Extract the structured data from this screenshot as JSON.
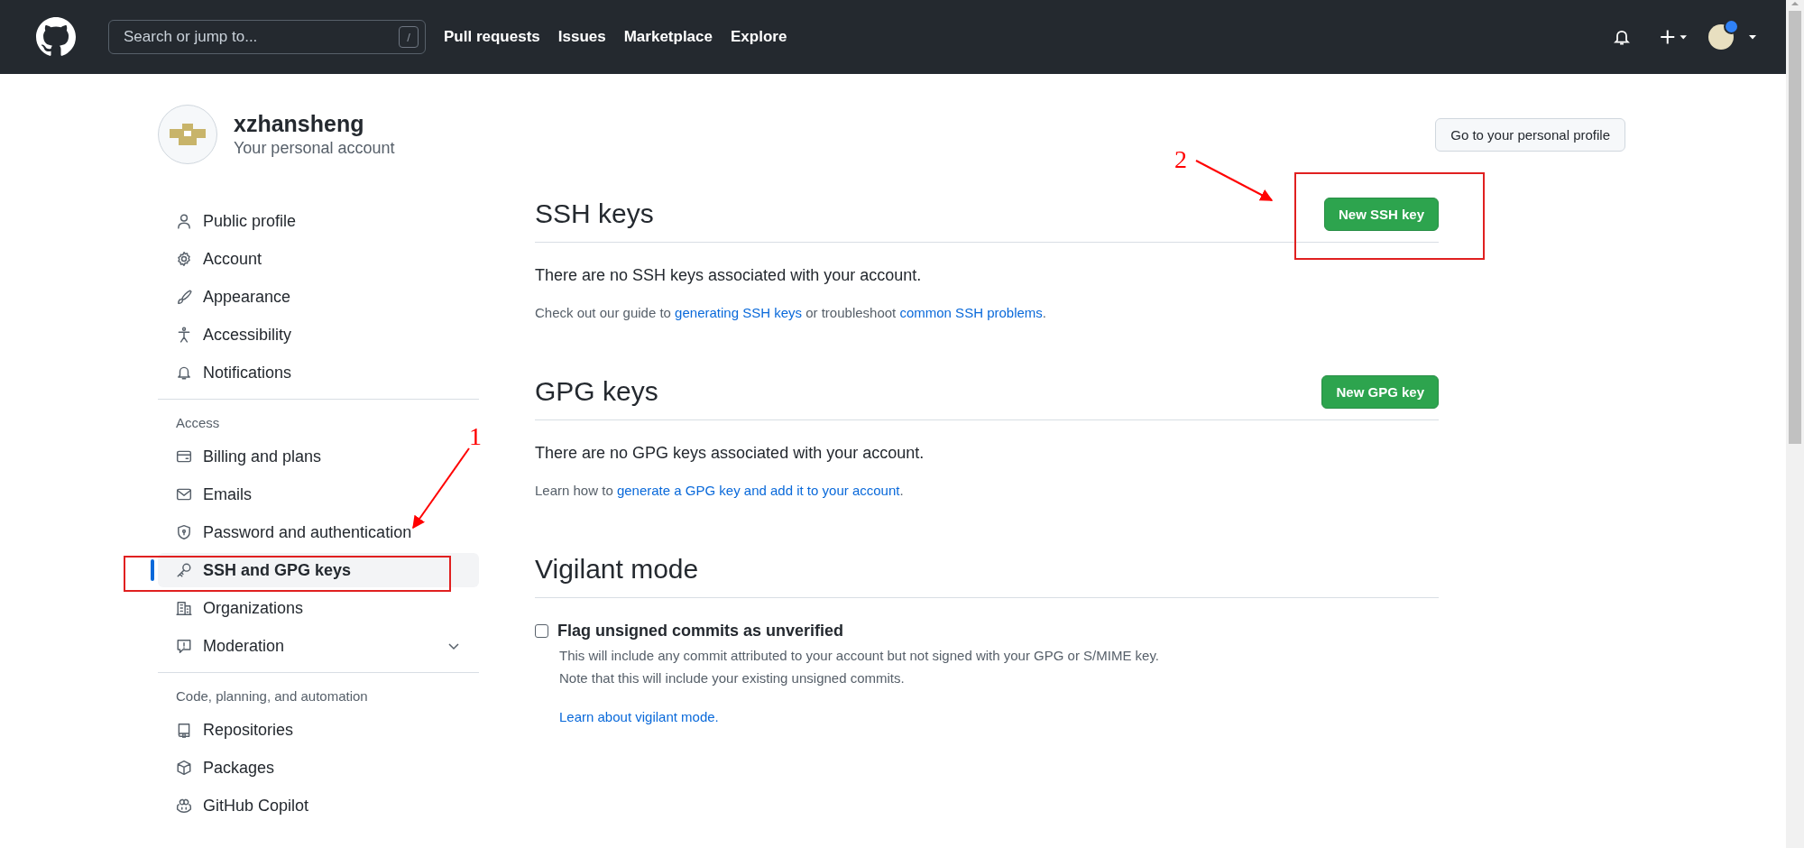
{
  "header": {
    "search": {
      "placeholder": "Search or jump to...",
      "shortcut": "/"
    },
    "nav": [
      "Pull requests",
      "Issues",
      "Marketplace",
      "Explore"
    ]
  },
  "profile": {
    "username": "xzhansheng",
    "subtitle": "Your personal account",
    "profile_button": "Go to your personal profile"
  },
  "sidebar": {
    "sections": [
      {
        "items": [
          {
            "label": "Public profile",
            "selected": false
          },
          {
            "label": "Account",
            "selected": false
          },
          {
            "label": "Appearance",
            "selected": false
          },
          {
            "label": "Accessibility",
            "selected": false
          },
          {
            "label": "Notifications",
            "selected": false
          }
        ]
      },
      {
        "heading": "Access",
        "items": [
          {
            "label": "Billing and plans",
            "selected": false
          },
          {
            "label": "Emails",
            "selected": false
          },
          {
            "label": "Password and authentication",
            "selected": false
          },
          {
            "label": "SSH and GPG keys",
            "selected": true
          },
          {
            "label": "Organizations",
            "selected": false
          },
          {
            "label": "Moderation",
            "selected": false,
            "expanded": false
          }
        ]
      },
      {
        "heading": "Code, planning, and automation",
        "items": [
          {
            "label": "Repositories",
            "selected": false
          },
          {
            "label": "Packages",
            "selected": false
          },
          {
            "label": "GitHub Copilot",
            "selected": false
          }
        ]
      }
    ]
  },
  "sections": [
    {
      "title": "SSH keys",
      "button": "New SSH key",
      "empty": "There are no SSH keys associated with your account.",
      "note": [
        {
          "text": "Check out our guide to "
        },
        {
          "link": "generating SSH keys"
        },
        {
          "text": " or troubleshoot "
        },
        {
          "link": "common SSH problems"
        },
        {
          "text": "."
        }
      ]
    },
    {
      "title": "GPG keys",
      "button": "New GPG key",
      "empty": "There are no GPG keys associated with your account.",
      "note": [
        {
          "text": "Learn how to "
        },
        {
          "link": "generate a GPG key and add it to your account"
        },
        {
          "text": "."
        }
      ]
    }
  ],
  "vigilant": {
    "title": "Vigilant mode",
    "checkbox": {
      "label": "Flag unsigned commits as unverified",
      "checked": false
    },
    "description": [
      "This will include any commit attributed to your account but not signed with your GPG or S/MIME key.",
      "Note that this will include your existing unsigned commits."
    ],
    "link": "Learn about vigilant mode."
  },
  "annotations": [
    {
      "number": "1"
    },
    {
      "number": "2"
    }
  ]
}
